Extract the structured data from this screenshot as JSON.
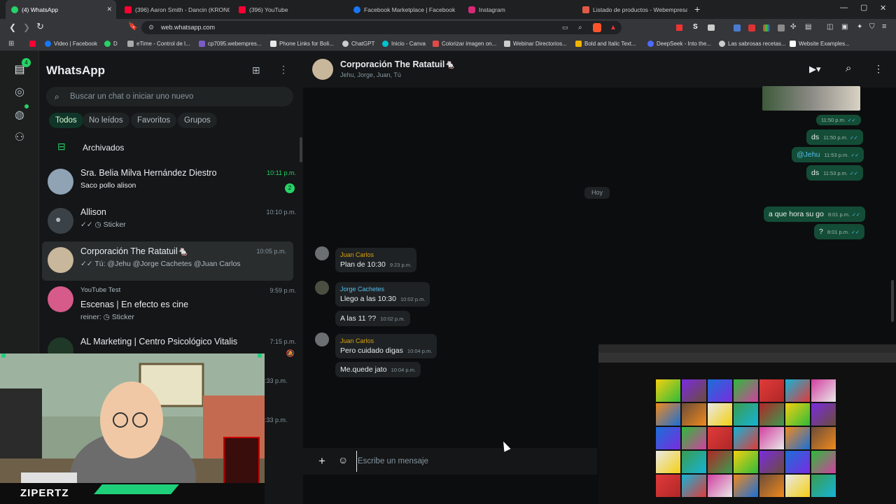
{
  "browser": {
    "tabs": [
      {
        "label": "(4) WhatsApp",
        "icon": "whatsapp-icon",
        "color": "#25d366"
      },
      {
        "label": "(396) Aaron Smith - Dancin (KRONO",
        "icon": "youtube-icon",
        "color": "#ff0033"
      },
      {
        "label": "(396) YouTube",
        "icon": "youtube-icon",
        "color": "#ff0033"
      },
      {
        "label": "Facebook Marketplace | Facebook",
        "icon": "facebook-icon",
        "color": "#1877f2"
      },
      {
        "label": "Instagram",
        "icon": "instagram-icon",
        "color": "#d62976"
      },
      {
        "label": "Listado de productos - Webempresa",
        "icon": "webempresa-icon",
        "color": "#e05a47"
      }
    ],
    "close_symbol": "✕",
    "newtab_symbol": "+",
    "url": "web.whatsapp.com",
    "bookmarks": [
      {
        "label": "",
        "color": "#ff0033"
      },
      {
        "label": "Video | Facebook",
        "color": "#1877f2"
      },
      {
        "label": "D",
        "color": "#25d366"
      },
      {
        "label": "eTime - Control de l...",
        "color": "#aaaaaa"
      },
      {
        "label": "cp7095.webempres...",
        "color": "#7b5cc7"
      },
      {
        "label": "Phone Links for Boli...",
        "color": "#e9e9e9"
      },
      {
        "label": "ChatGPT",
        "color": "#cccccc"
      },
      {
        "label": "Inicio - Canva",
        "color": "#00c4cc"
      },
      {
        "label": "Colorizar imagen on...",
        "color": "#e34a4a"
      },
      {
        "label": "Webinar Directorios...",
        "color": "#cccccc"
      },
      {
        "label": "Bold and Italic Text...",
        "color": "#f0b400"
      },
      {
        "label": "DeepSeek - Into the...",
        "color": "#4d6bfe"
      },
      {
        "label": "Las sabrosas recetas...",
        "color": "#cccccc"
      },
      {
        "label": "Website Examples...",
        "color": "#ffffff"
      }
    ]
  },
  "sidebar": {
    "title": "WhatsApp",
    "search_placeholder": "Buscar un chat o iniciar uno nuevo",
    "filters": [
      "Todos",
      "No leídos",
      "Favoritos",
      "Grupos"
    ],
    "archived": "Archivados",
    "status_badge": "4",
    "chats": [
      {
        "name": "Sra. Belia Milva Hernández Diestro",
        "message": "Saco pollo alison",
        "time": "10:11 p.m.",
        "unread": "2",
        "avatar_color": "#8fa3b5"
      },
      {
        "name": "Allison",
        "message": "✓✓ ◷ Sticker",
        "time": "10:10 p.m.",
        "avatar_color": "#3b4247"
      },
      {
        "name": "Corporación The Ratatuil🐁",
        "message": "✓✓ Tú: @Jehu @Jorge Cachetes @Juan Carlos",
        "time": "10:05 p.m.",
        "avatar_color": "#c9b79c"
      },
      {
        "name": "Escenas | En efecto es cine",
        "prefix": "YouTube Test",
        "message": "reiner: ◷ Sticker",
        "time": "9:59 p.m.",
        "avatar_color": "#d65a8a"
      },
      {
        "name": "AL Marketing | Centro Psicológico Vitalis",
        "message": "",
        "time": "7:15 p.m.",
        "avatar_color": "#203828"
      }
    ],
    "partial_times": [
      ":33 p.m.",
      ":33 p.m."
    ]
  },
  "conversation": {
    "group_name": "Corporación The Ratatuil🐁",
    "members": "Jehu, Jorge, Juan, Tú",
    "day_divider": "Hoy",
    "outgoing": [
      {
        "text": "",
        "time": "11:50 p.m."
      },
      {
        "text": "ds",
        "time": "11:50 p.m."
      },
      {
        "text": "@Jehu",
        "time": "11:53 p.m.",
        "mention": true
      },
      {
        "text": "ds",
        "time": "11:53 p.m."
      },
      {
        "text": "a que hora su go",
        "time": "8:01 p.m."
      },
      {
        "text": "?",
        "time": "8:01 p.m."
      }
    ],
    "incoming": [
      {
        "sender": "Juan Carlos",
        "sender_color": "#d6a20c",
        "text": "Plan de 10:30",
        "time": "9:23 p.m."
      },
      {
        "sender": "Jorge Cachetes",
        "sender_color": "#53bdeb",
        "text": "Llego a las 10:30",
        "time": "10:02 p.m."
      },
      {
        "sender": "",
        "text": "A las 11 ??",
        "time": "10:02 p.m."
      },
      {
        "sender": "Juan Carlos",
        "sender_color": "#d6a20c",
        "text": "Pero cuidado digas",
        "time": "10:04 p.m."
      },
      {
        "sender": "",
        "text": "Me.quede jato",
        "time": "10:04 p.m."
      }
    ],
    "composer_placeholder": "Escribe un mensaje",
    "check": "✓✓"
  },
  "stream": {
    "name": "ZIPERTZ",
    "accent": "#1fd07a"
  },
  "colors": {
    "accent": "#25d366",
    "out_bubble": "#144d37",
    "in_bubble": "#1f2224"
  }
}
